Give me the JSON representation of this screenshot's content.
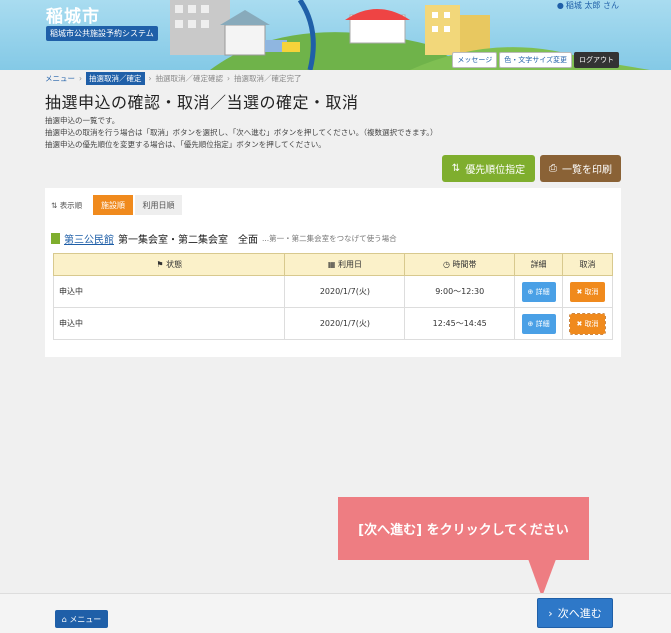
{
  "header": {
    "city": "稲城市",
    "system": "稲城市公共施設予約システム",
    "user": "稲城 太郎 さん",
    "buttons": [
      "メッセージ",
      "色・文字サイズ変更",
      "ログアウト"
    ]
  },
  "breadcrumb": [
    "メニュー",
    "抽選取消／確定",
    "抽選取消／確定確認",
    "抽選取消／確定完了"
  ],
  "page": {
    "title": "抽選申込の確認・取消／当選の確定・取消",
    "desc": [
      "抽選申込の一覧です。",
      "抽選申込の取消を行う場合は「取消」ボタンを選択し、「次へ進む」ボタンを押してください。（複数選択できます。）",
      "抽選申込の優先順位を変更する場合は、「優先順位指定」ボタンを押してください。"
    ]
  },
  "actions": {
    "priority": "優先順位指定",
    "print": "一覧を印刷"
  },
  "sort": {
    "label": "表示順",
    "facility_order": "施設順",
    "date_order": "利用日順"
  },
  "facility": {
    "name": "第三公民館",
    "room": "第一集会室・第二集会室　全面",
    "note": "...第一・第二集会室をつなげて使う場合"
  },
  "table": {
    "headers": [
      "状態",
      "利用日",
      "時間帯",
      "詳細",
      "取消"
    ],
    "rows": [
      {
        "status": "申込中",
        "date": "2020/1/7(火)",
        "time": "9:00～12:30",
        "detail": "詳細",
        "cancel": "取消"
      },
      {
        "status": "申込中",
        "date": "2020/1/7(火)",
        "time": "12:45～14:45",
        "detail": "詳細",
        "cancel": "取消"
      }
    ]
  },
  "tooltip": "[次へ進む] をクリックしてください",
  "footer": {
    "menu": "メニュー",
    "next": "次へ進む"
  }
}
